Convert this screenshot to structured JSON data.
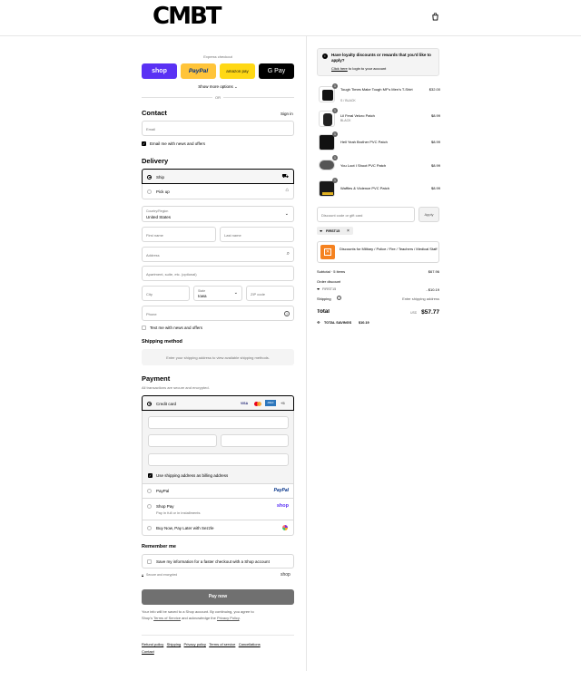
{
  "brand": {
    "logo": "CMBT"
  },
  "express": {
    "title": "Express checkout",
    "buttons": [
      "shop",
      "PayPal",
      "amazon pay",
      "G Pay"
    ],
    "show_more": "Show more options",
    "or": "OR"
  },
  "contact": {
    "title": "Contact",
    "sign_in": "Sign in",
    "email_placeholder": "Email",
    "email_news": "Email me with news and offers"
  },
  "delivery": {
    "title": "Delivery",
    "ship": "Ship",
    "pickup": "Pick up",
    "country_label": "Country/Region",
    "country_value": "United States",
    "first_name": "First name",
    "last_name": "Last name",
    "address": "Address",
    "apartment": "Apartment, suite, etc. (optional)",
    "city": "City",
    "state_label": "State",
    "state_value": "Iowa",
    "zip": "ZIP code",
    "phone": "Phone",
    "text_news": "Text me with news and offers"
  },
  "shipping_method": {
    "title": "Shipping method",
    "placeholder": "Enter your shipping address to view available shipping methods."
  },
  "payment": {
    "title": "Payment",
    "subtitle": "All transactions are secure and encrypted.",
    "credit_card": "Credit card",
    "card_brands": [
      "VISA",
      "MC",
      "AMEX",
      "+5"
    ],
    "billing_same": "Use shipping address as billing address",
    "paypal": "PayPal",
    "paypal_logo": "PayPal",
    "shop_pay": "Shop Pay",
    "shop_pay_sub": "Pay in full or in installments",
    "shop_logo": "shop",
    "sezzle": "Buy Now, Pay Later with Sezzle"
  },
  "remember": {
    "title": "Remember me",
    "save_info": "Save my information for a faster checkout with a Shop account",
    "secure": "Secure and encrypted",
    "shop_logo": "shop"
  },
  "pay_now": "Pay now",
  "legal": {
    "line1": "Your info will be saved to a Shop account. By continuing, you agree to",
    "line2_pre": "Shop's ",
    "terms": "Terms of Service",
    "line2_mid": " and acknowledge the ",
    "privacy": "Privacy Policy",
    "line2_end": "."
  },
  "footer_links": [
    "Refund policy",
    "Shipping",
    "Privacy policy",
    "Terms of service",
    "Cancellations",
    "Contact"
  ],
  "loyalty": {
    "title": "Have loyalty discounts or rewards that you'd like to apply?",
    "link": "Click here",
    "rest": " to login to your account"
  },
  "items": [
    {
      "name": "Tough Times Make Tough MF's Men's T-Shirt",
      "variant": "S / BLACK",
      "price": "$32.00",
      "qty": "1"
    },
    {
      "name": "Lil Feral Velcro Patch",
      "variant": "BLACK",
      "price": "$8.99",
      "qty": "1"
    },
    {
      "name": "Hell Yeah Brother PVC Patch",
      "variant": "",
      "price": "$8.99",
      "qty": "1"
    },
    {
      "name": "You Loot I Shoot PVC Patch",
      "variant": "",
      "price": "$8.99",
      "qty": "1"
    },
    {
      "name": "Waffles & Violence PVC Patch",
      "variant": "",
      "price": "$8.99",
      "qty": "1"
    }
  ],
  "discount": {
    "placeholder": "Discount code or gift card",
    "apply": "Apply",
    "code": "FIRST15",
    "military": "Discounts for Military / Police / Fire / Teachers / Medical Staff"
  },
  "summary": {
    "subtotal_label": "Subtotal · 5 items",
    "subtotal": "$67.96",
    "order_discount": "Order discount",
    "code": "FIRST15",
    "discount_value": "- $10.19",
    "shipping_label": "Shipping",
    "shipping_value": "Enter shipping address",
    "total_label": "Total",
    "currency": "USD",
    "total": "$57.77",
    "savings_label": "TOTAL SAVINGS",
    "savings": "$10.19"
  }
}
